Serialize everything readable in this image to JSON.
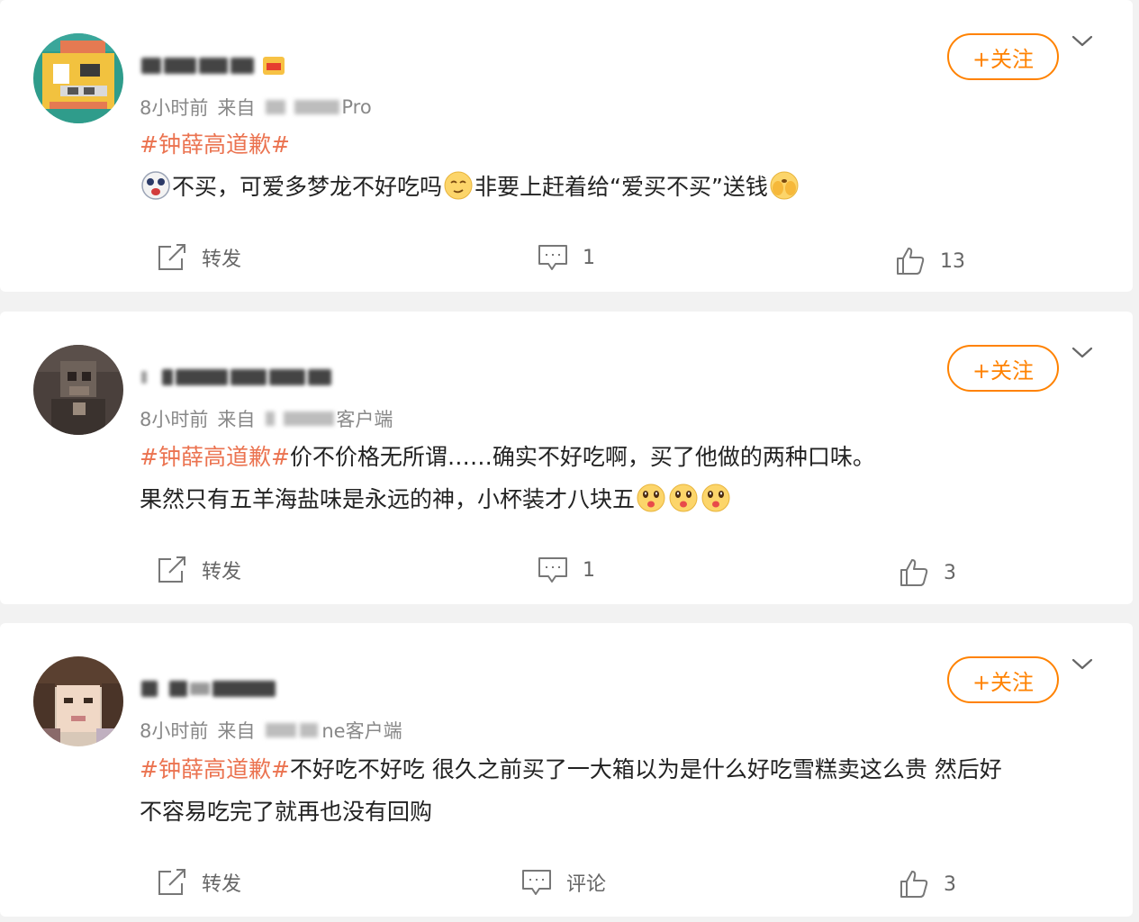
{
  "colors": {
    "accent": "#ff8200",
    "hashtag": "#eb7350",
    "text": "#222222",
    "meta": "#888888",
    "action": "#666666",
    "page_background": "#f2f2f2"
  },
  "posts": [
    {
      "username": "",
      "time": "8小时前",
      "source_prefix": "来自",
      "source_visible": "Pro",
      "follow_label": "+关注",
      "hashtag": "#钟薛高道歉#",
      "content_parts": [
        "不买，可爱多梦龙不好吃吗",
        "非要上赶着给“爱买不买”送钱"
      ],
      "emojis": [
        "crazy-face-icon",
        "smirk-face-icon",
        "facepalm-face-icon"
      ],
      "actions": {
        "repost_label": "转发",
        "comment_label": "1",
        "like_label": "13"
      }
    },
    {
      "username": "",
      "time": "8小时前",
      "source_prefix": "来自",
      "source_visible": "客户端",
      "follow_label": "+关注",
      "hashtag": "#钟薛高道歉#",
      "content_line1": "价不价格无所谓……确实不好吃啊，买了他做的两种口味。",
      "content_line2": "果然只有五羊海盐味是永远的神，小杯装才八块五",
      "emojis": [
        "yummy-face-icon",
        "yummy-face-icon",
        "yummy-face-icon"
      ],
      "actions": {
        "repost_label": "转发",
        "comment_label": "1",
        "like_label": "3"
      }
    },
    {
      "username": "",
      "time": "8小时前",
      "source_prefix": "来自",
      "source_visible": "ne客户端",
      "follow_label": "+关注",
      "hashtag": "#钟薛高道歉#",
      "content_line1": "不好吃不好吃 很久之前买了一大箱以为是什么好吃雪糕卖这么贵 然后好",
      "content_line2": "不容易吃完了就再也没有回购",
      "actions": {
        "repost_label": "转发",
        "comment_label": "评论",
        "like_label": "3"
      }
    }
  ]
}
